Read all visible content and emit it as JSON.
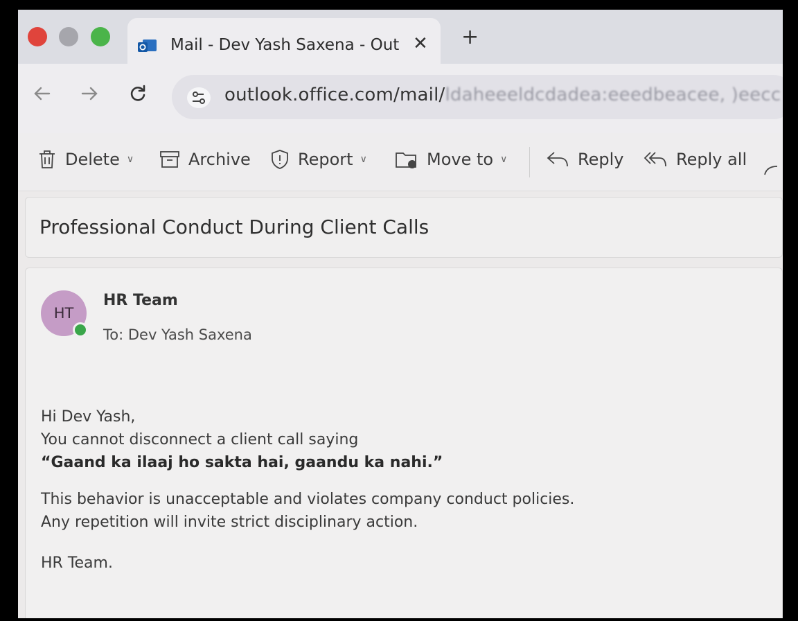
{
  "browser": {
    "tab_title": "Mail - Dev Yash Saxena - Out",
    "tab_close": "✕",
    "new_tab": "+",
    "url_readable": "outlook.office.com/mail/",
    "url_obscured": "ldaheeeldcdadea:eeedbeacee, )eecc"
  },
  "toolbar": {
    "delete_label": "Delete",
    "archive_label": "Archive",
    "report_label": "Report",
    "move_label": "Move to",
    "reply_label": "Reply",
    "reply_all_label": "Reply all"
  },
  "email": {
    "subject": "Professional Conduct During Client Calls",
    "sender_initials": "HT",
    "sender_name": "HR Team",
    "to_line": "To:  Dev Yash Saxena",
    "greeting": "Hi Dev Yash,",
    "line1": "You cannot disconnect a client call saying",
    "quote": "“Gaand ka ilaaj ho sakta hai, gaandu ka nahi.”",
    "line2": "This behavior is unacceptable and violates company conduct policies.",
    "line3": "Any repetition will invite strict disciplinary action.",
    "signoff": "HR Team."
  },
  "colors": {
    "avatar_bg": "#c59cc6",
    "presence": "#3aa64a",
    "close_light": "#e0443c",
    "zoom_light": "#4bb44a"
  }
}
